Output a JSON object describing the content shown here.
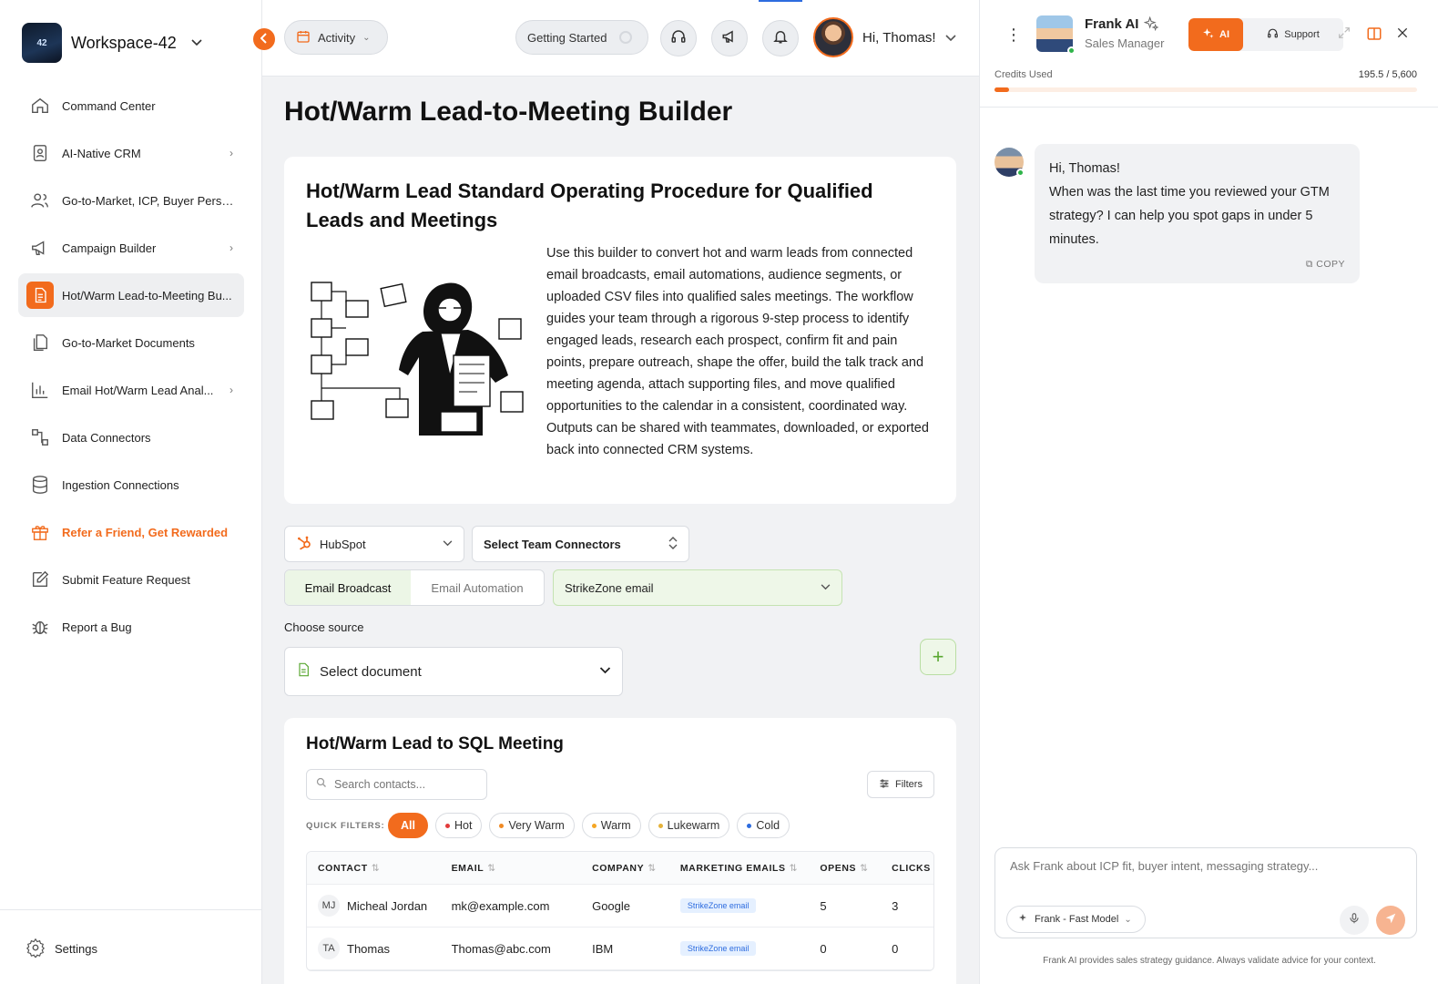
{
  "workspace": {
    "name": "Workspace-42",
    "logo_text": "42"
  },
  "sidebar": {
    "items": [
      {
        "label": "Command Center",
        "icon": "home-icon"
      },
      {
        "label": "AI-Native CRM",
        "icon": "contacts-icon"
      },
      {
        "label": "Go-to-Market, ICP, Buyer Perso...",
        "icon": "users-icon"
      },
      {
        "label": "Campaign Builder",
        "icon": "megaphone-icon"
      },
      {
        "label": "Hot/Warm Lead-to-Meeting Bu...",
        "icon": "document-icon"
      },
      {
        "label": "Go-to-Market Documents",
        "icon": "documents-icon"
      },
      {
        "label": "Email Hot/Warm Lead Anal...",
        "icon": "bar-chart-icon"
      },
      {
        "label": "Data Connectors",
        "icon": "connector-icon"
      },
      {
        "label": "Ingestion Connections",
        "icon": "database-icon"
      },
      {
        "label": "Refer a Friend, Get Rewarded",
        "icon": "gift-icon"
      },
      {
        "label": "Submit Feature Request",
        "icon": "edit-icon"
      },
      {
        "label": "Report a Bug",
        "icon": "bug-icon"
      }
    ],
    "settings_label": "Settings"
  },
  "topbar": {
    "activity_label": "Activity",
    "getting_started_label": "Getting Started",
    "greeting": "Hi, Thomas!"
  },
  "main": {
    "page_title": "Hot/Warm Lead-to-Meeting Builder",
    "sop_title": "Hot/Warm Lead Standard Operating Procedure for Qualified Leads and Meetings",
    "sop_text": "Use this builder to convert hot and warm leads from connected email broadcasts, email automations, audience segments, or uploaded CSV files into qualified sales meetings. The workflow guides your team through a rigorous 9-step process to identify engaged leads, research each prospect, confirm fit and pain points, prepare outreach, shape the offer, build the talk track and meeting agenda, attach supporting files, and move qualified opportunities to the calendar in a consistent, coordinated way. Outputs can be shared with teammates, downloaded, or exported back into connected CRM systems.",
    "crm_select": "HubSpot",
    "team_select": "Select Team Connectors",
    "tabs": [
      {
        "label": "Email Broadcast"
      },
      {
        "label": "Email Automation"
      }
    ],
    "email_select": "StrikeZone email",
    "choose_source_label": "Choose source",
    "document_select": "Select document"
  },
  "table": {
    "title": "Hot/Warm Lead to SQL Meeting",
    "search_placeholder": "Search contacts...",
    "filters_label": "Filters",
    "quick_filters_label": "QUICK FILTERS:",
    "chips": [
      {
        "label": "All",
        "color": "#f26b1d"
      },
      {
        "label": "Hot",
        "color": "#e23b3b"
      },
      {
        "label": "Very Warm",
        "color": "#f08a24"
      },
      {
        "label": "Warm",
        "color": "#f5a623"
      },
      {
        "label": "Lukewarm",
        "color": "#e5b23a"
      },
      {
        "label": "Cold",
        "color": "#2d6cdf"
      }
    ],
    "columns": [
      "CONTACT",
      "EMAIL",
      "COMPANY",
      "MARKETING EMAILS",
      "OPENS",
      "CLICKS"
    ],
    "rows": [
      {
        "initials": "MJ",
        "name": "Micheal Jordan",
        "email": "mk@example.com",
        "company": "Google",
        "marketing": "StrikeZone email",
        "opens": "5",
        "clicks": "3"
      },
      {
        "initials": "TA",
        "name": "Thomas",
        "email": "Thomas@abc.com",
        "company": "IBM",
        "marketing": "StrikeZone email",
        "opens": "0",
        "clicks": "0"
      }
    ]
  },
  "panel": {
    "name": "Frank AI",
    "role": "Sales Manager",
    "ai_label": "AI",
    "support_label": "Support",
    "credits_label": "Credits Used",
    "credits_value": "195.5 / 5,600",
    "credits_fraction": 0.035,
    "message_greeting": "Hi, Thomas!",
    "message_body": "When was the last time you reviewed your GTM strategy? I can help you spot gaps in under 5 minutes.",
    "copy_label": "COPY",
    "input_placeholder": "Ask Frank about ICP fit, buyer intent, messaging strategy...",
    "model_label": "Frank - Fast Model",
    "disclaimer": "Frank AI provides sales strategy guidance. Always validate advice for your context."
  },
  "colors": {
    "accent": "#f26b1d",
    "green_accent": "#5aa832",
    "link_blue": "#2d6cdf"
  }
}
